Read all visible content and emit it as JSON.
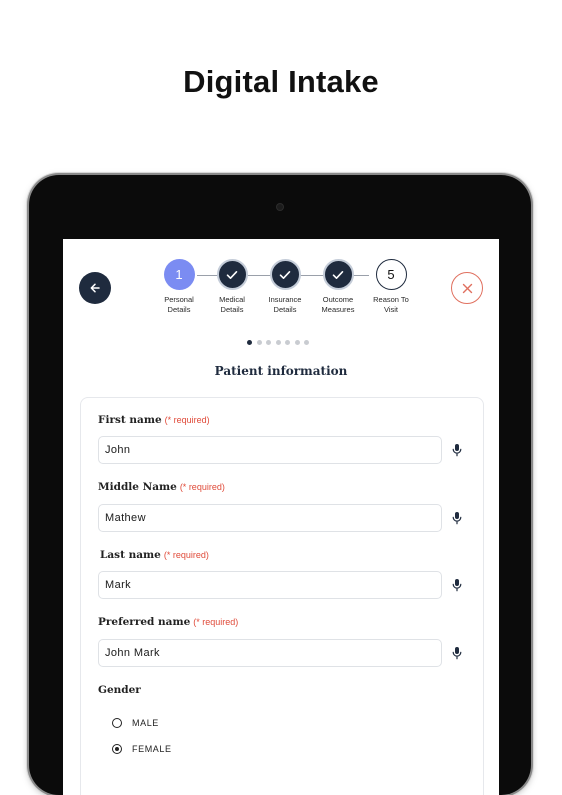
{
  "hero": {
    "title": "Digital Intake"
  },
  "stepper": {
    "steps": [
      {
        "number": "1",
        "label_line1": "Personal",
        "label_line2": "Details",
        "state": "active"
      },
      {
        "number": "",
        "label_line1": "Medical",
        "label_line2": "Details",
        "state": "done"
      },
      {
        "number": "",
        "label_line1": "Insurance",
        "label_line2": "Details",
        "state": "done"
      },
      {
        "number": "",
        "label_line1": "Outcome",
        "label_line2": "Measures",
        "state": "done"
      },
      {
        "number": "5",
        "label_line1": "Reason To",
        "label_line2": "Visit",
        "state": "todo"
      }
    ],
    "pager": {
      "total": 7,
      "current": 1
    }
  },
  "section": {
    "title": "Patient information"
  },
  "form": {
    "first_name": {
      "label": "First name",
      "required": "(* required)",
      "value": "John"
    },
    "middle_name": {
      "label": "Middle Name",
      "required": "(* required)",
      "value": "Mathew"
    },
    "last_name": {
      "label": "Last name",
      "required": "(* required)",
      "value": "Mark"
    },
    "preferred_name": {
      "label": "Preferred name",
      "required": "(* required)",
      "value": "John Mark"
    },
    "gender": {
      "label": "Gender",
      "options": [
        {
          "label": "MALE",
          "selected": false
        },
        {
          "label": "FEMALE",
          "selected": true
        }
      ]
    }
  },
  "icons": {
    "back": "arrow-left-icon",
    "close": "close-icon",
    "check": "check-icon",
    "mic": "microphone-icon"
  },
  "colors": {
    "navy": "#1f2b3e",
    "active_step": "#7b8cf2",
    "required": "#e04b3a",
    "close_border": "#e0705f"
  }
}
